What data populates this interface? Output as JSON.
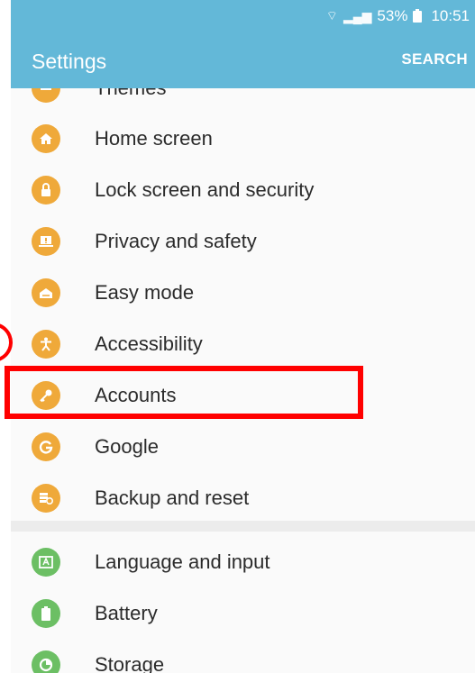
{
  "status_bar": {
    "battery_percent": "53%",
    "time": "10:51"
  },
  "app_bar": {
    "title": "Settings",
    "search_label": "SEARCH"
  },
  "settings_items": [
    {
      "label": "Themes",
      "icon": "theme-icon"
    },
    {
      "label": "Home screen",
      "icon": "home-icon"
    },
    {
      "label": "Lock screen and security",
      "icon": "lock-icon"
    },
    {
      "label": "Privacy and safety",
      "icon": "privacy-icon"
    },
    {
      "label": "Easy mode",
      "icon": "easy-mode-icon"
    },
    {
      "label": "Accessibility",
      "icon": "accessibility-icon"
    },
    {
      "label": "Accounts",
      "icon": "key-icon"
    },
    {
      "label": "Google",
      "icon": "google-icon"
    },
    {
      "label": "Backup and reset",
      "icon": "backup-icon"
    },
    {
      "label": "Language and input",
      "icon": "language-icon"
    },
    {
      "label": "Battery",
      "icon": "battery-icon"
    },
    {
      "label": "Storage",
      "icon": "storage-icon"
    }
  ],
  "colors": {
    "app_bar": "#63b8d8",
    "orange_icon": "#efa93a",
    "green_icon": "#6cbf64",
    "highlight": "#ff0000"
  }
}
